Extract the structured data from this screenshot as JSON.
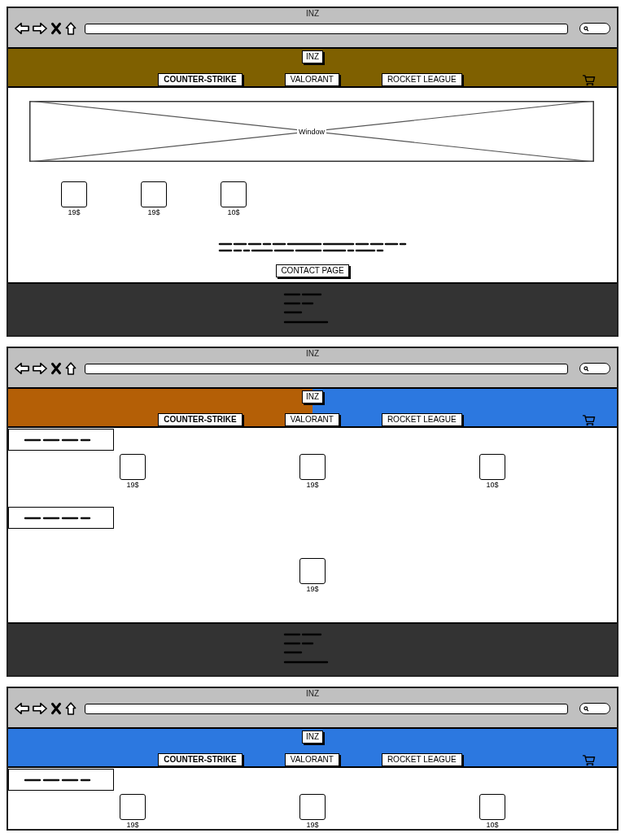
{
  "screens": [
    {
      "kind": "home",
      "window_title": "INZ",
      "header": {
        "logo": "INZ",
        "bands": [
          {
            "color": "#7f6000"
          }
        ],
        "nav": [
          {
            "label": "COUNTER-STRIKE",
            "selected": true
          },
          {
            "label": "VALORANT",
            "selected": false
          },
          {
            "label": "ROCKET LEAGUE",
            "selected": false
          }
        ]
      },
      "hero": {
        "label": "Window"
      },
      "products": [
        {
          "price": "19$"
        },
        {
          "price": "19$"
        },
        {
          "price": "10$"
        }
      ],
      "button": "CONTACT PAGE",
      "footer": true
    },
    {
      "kind": "catalog",
      "window_title": "INZ",
      "header": {
        "logo": "INZ",
        "bands": [
          {
            "color": "#b45f06"
          },
          {
            "color": "#2c78e0"
          }
        ],
        "nav": [
          {
            "label": "COUNTER-STRIKE",
            "selected": true
          },
          {
            "label": "VALORANT",
            "selected": false
          },
          {
            "label": "ROCKET LEAGUE",
            "selected": false
          }
        ]
      },
      "sections": [
        {
          "kind": "row",
          "products": [
            {
              "price": "19$"
            },
            {
              "price": "19$"
            },
            {
              "price": "10$"
            }
          ]
        },
        {
          "kind": "single",
          "products": [
            {
              "price": "19$"
            }
          ]
        }
      ],
      "footer": true
    },
    {
      "kind": "catalog",
      "window_title": "INZ",
      "header": {
        "logo": "INZ",
        "bands": [
          {
            "color": "#2c78e0"
          }
        ],
        "nav": [
          {
            "label": "COUNTER-STRIKE",
            "selected": true
          },
          {
            "label": "VALORANT",
            "selected": false
          },
          {
            "label": "ROCKET LEAGUE",
            "selected": false
          }
        ]
      },
      "sections": [
        {
          "kind": "row",
          "products": [
            {
              "price": "19$"
            },
            {
              "price": "19$"
            },
            {
              "price": "10$"
            }
          ]
        }
      ]
    }
  ]
}
